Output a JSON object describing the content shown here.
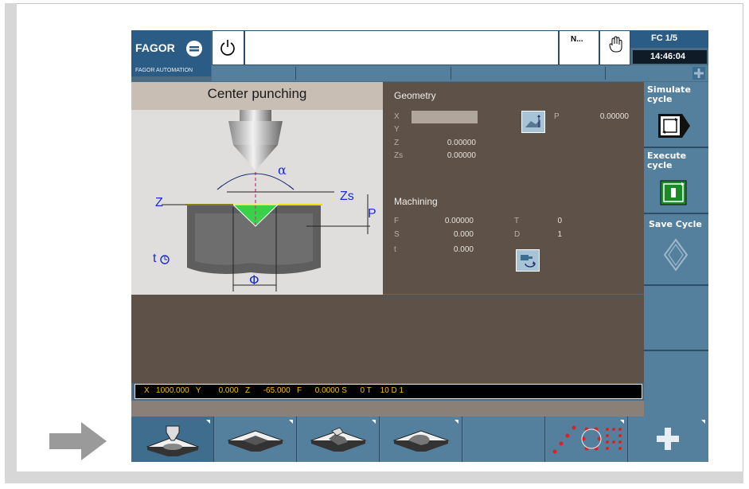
{
  "header": {
    "logo_text": "FAGOR",
    "logo_subtext": "FAGOR AUTOMATION",
    "message": "",
    "n_label": "N...",
    "fc_label": "FC 1/5",
    "time": "14:46:04"
  },
  "cycle": {
    "title": "Center punching",
    "diagram_labels": {
      "alpha": "α",
      "z": "Z",
      "zs": "Zs",
      "p": "P",
      "phi": "Φ",
      "t": "t"
    }
  },
  "geometry": {
    "title": "Geometry",
    "fields": [
      {
        "label": "X",
        "value": ""
      },
      {
        "label": "Y",
        "value": ""
      },
      {
        "label": "Z",
        "value": "0.00000"
      },
      {
        "label": "Zs",
        "value": "0.00000"
      }
    ],
    "p_label": "P",
    "p_value": "0.00000"
  },
  "machining": {
    "title": "Machining",
    "fields": [
      {
        "label": "F",
        "value": "0.00000"
      },
      {
        "label": "S",
        "value": "0.000"
      },
      {
        "label": "t",
        "value": "0.000"
      }
    ],
    "tool": [
      {
        "label": "T",
        "value": "0"
      },
      {
        "label": "D",
        "value": "1"
      }
    ]
  },
  "status_bar": {
    "text": "X   1000.000   Y        0.000   Z      -65.000   F      0.0000 S      0 T    10 D 1"
  },
  "right_softkeys": [
    {
      "label": "Simulate cycle",
      "icon": "simulate-cycle-icon"
    },
    {
      "label": "Execute cycle",
      "icon": "execute-cycle-icon"
    },
    {
      "label": "Save Cycle",
      "icon": "save-cycle-icon"
    },
    {
      "label": "",
      "icon": ""
    },
    {
      "label": "",
      "icon": ""
    }
  ],
  "bottom_softkeys": [
    {
      "icon": "center-punching-icon"
    },
    {
      "icon": "pocket-icon"
    },
    {
      "icon": "profile-pocket-icon"
    },
    {
      "icon": "boss-icon"
    },
    {
      "icon": ""
    },
    {
      "icon": "multiple-positioning-icon"
    },
    {
      "icon": "plus-icon"
    }
  ],
  "colors": {
    "screen_blue": "#54809d",
    "panel_brown": "#5e5248",
    "status_yellow": "#f2c200",
    "diagram_blue": "#1a2ad6"
  }
}
